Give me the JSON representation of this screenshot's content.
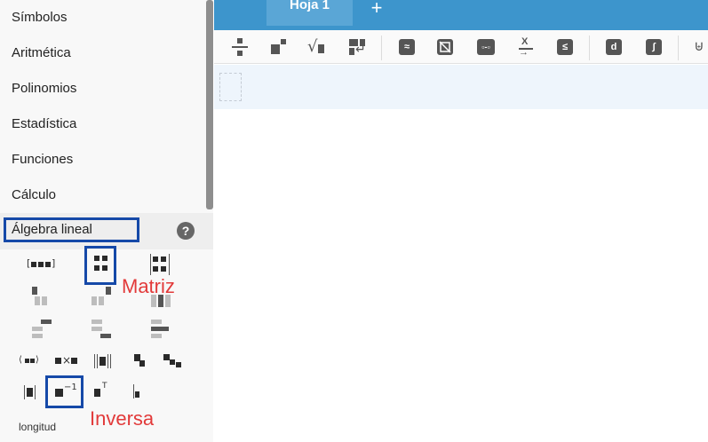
{
  "sidebar": {
    "categories": [
      {
        "label": "Símbolos"
      },
      {
        "label": "Aritmética"
      },
      {
        "label": "Polinomios"
      },
      {
        "label": "Estadística"
      },
      {
        "label": "Funciones"
      },
      {
        "label": "Cálculo"
      }
    ],
    "active_category": "Álgebra lineal",
    "help": "?",
    "tool_texts": {
      "superscript_inverse": "−1",
      "superscript_transpose": "T",
      "cross": "×",
      "longitud": "longitud"
    }
  },
  "annotations": {
    "matrix": "Matriz",
    "inverse": "Inversa"
  },
  "tabs": {
    "sheet": "Hoja 1",
    "add": "+"
  },
  "toolbar": {
    "solve_label": "X",
    "deriv_label": "d",
    "integral_label": "∫"
  },
  "colors": {
    "tabbar": "#3d95cc",
    "highlight": "#1549a8",
    "annotation": "#e23a3a",
    "input_row": "#eef5fc"
  }
}
